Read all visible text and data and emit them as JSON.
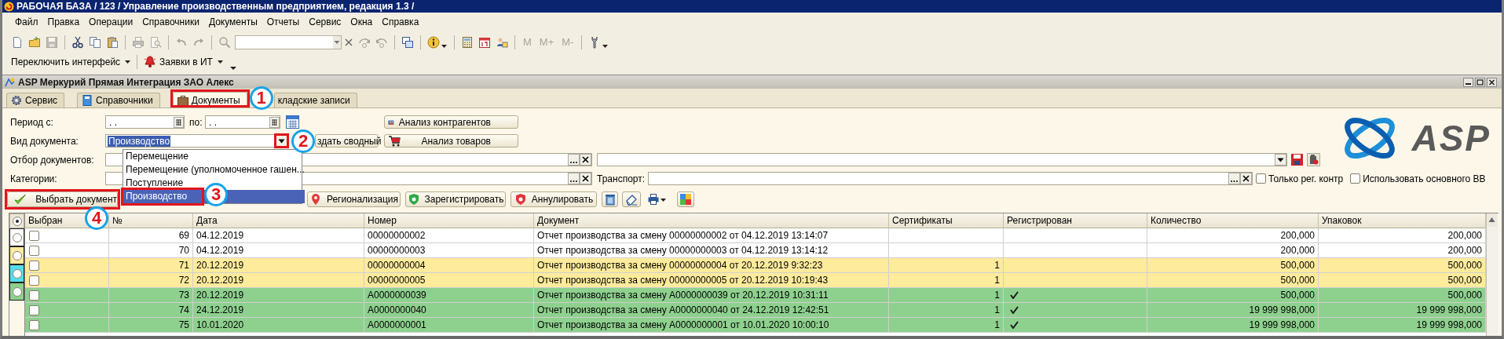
{
  "window": {
    "title": "РАБОЧАЯ БАЗА / 123 /  Управление производственным предприятием, редакция 1.3 /"
  },
  "menu": [
    "Файл",
    "Правка",
    "Операции",
    "Справочники",
    "Документы",
    "Отчеты",
    "Сервис",
    "Окна",
    "Справка"
  ],
  "toolbar": [
    {
      "kind": "button",
      "disabled": false
    },
    {
      "kind": "button",
      "disabled": false
    },
    {
      "kind": "button",
      "disabled": true
    },
    {
      "kind": "separator"
    },
    {
      "kind": "button",
      "disabled": false
    },
    {
      "kind": "button",
      "disabled": false
    },
    {
      "kind": "button",
      "disabled": false
    },
    {
      "kind": "separator"
    },
    {
      "kind": "button",
      "disabled": true
    },
    {
      "kind": "button",
      "disabled": true
    },
    {
      "kind": "separator"
    },
    {
      "kind": "button",
      "disabled": true
    },
    {
      "kind": "button",
      "disabled": true
    },
    {
      "kind": "separator"
    },
    {
      "kind": "button",
      "disabled": true
    },
    {
      "kind": "search"
    },
    {
      "kind": "button",
      "disabled": true
    },
    {
      "kind": "button",
      "disabled": true
    },
    {
      "kind": "separator"
    },
    {
      "kind": "button",
      "disabled": false
    },
    {
      "kind": "separator"
    },
    {
      "kind": "menu",
      "disabled": false
    },
    {
      "kind": "separator"
    },
    {
      "kind": "button",
      "disabled": false
    },
    {
      "kind": "button",
      "disabled": false
    },
    {
      "kind": "button",
      "disabled": false
    },
    {
      "kind": "separator"
    },
    {
      "kind": "text",
      "label": "M",
      "disabled": true
    },
    {
      "kind": "text",
      "label": "M+",
      "disabled": true
    },
    {
      "kind": "text",
      "label": "M-",
      "disabled": true
    },
    {
      "kind": "separator"
    },
    {
      "kind": "menu",
      "disabled": false
    }
  ],
  "toolbar_2": [
    {
      "kind": "menu",
      "label": "Переключить интерфейс"
    },
    {
      "kind": "bell-menu",
      "label": "Заявки в ИТ"
    }
  ],
  "form": {
    "title": "ASP Меркурий Прямая Интеграция ЗАО Алекс",
    "tabs": [
      {
        "label": "Сервис",
        "selected": false
      },
      {
        "label": "Справочники",
        "selected": false
      },
      {
        "label": "Документы",
        "selected": true,
        "callout": "1"
      },
      {
        "label": "кладские записи",
        "selected": false
      }
    ],
    "period_label": "Период с:",
    "period_from": ". .",
    "period_to_label": "по:",
    "period_to": ". .",
    "doc_type_label": "Вид документа:",
    "doc_type_value": "Производство",
    "doc_type_value_selected": true,
    "doc_type_callout": "2",
    "doc_type_options": [
      {
        "label": "Перемещение",
        "selected": false
      },
      {
        "label": "Перемещение (уполномоченное гашен...",
        "selected": false
      },
      {
        "label": "Поступление",
        "selected": false
      },
      {
        "label": "Производство",
        "selected": true,
        "callout": "3"
      }
    ],
    "create_button": "здать сводный",
    "side_buttons": [
      "Анализ контрагентов",
      "Анализ товаров"
    ],
    "doc_filter_label": "Отбор документов:",
    "category_label": "Категории:",
    "transport_label": "Транспорт:",
    "options": [
      {
        "label": "Только рег. контр",
        "checked": false
      },
      {
        "label": "Использовать основного ВВ",
        "checked": false
      }
    ],
    "actions": [
      {
        "label": "Выбрать документ",
        "callout": "4"
      },
      {
        "label": "Регионализация"
      },
      {
        "label": "Зарегистрировать"
      },
      {
        "label": "Аннулировать"
      }
    ],
    "logo": {
      "text": "ASP"
    }
  },
  "table": {
    "columns": [
      "Выбран",
      "№",
      "Дата",
      "Номер",
      "Документ",
      "Сертификаты",
      "Регистрирован",
      "Количество",
      "Упаковок"
    ],
    "legend": [
      {
        "selected": true
      },
      {
        "selected": false,
        "color": "#ffffff"
      },
      {
        "selected": false,
        "color": "#ffeb9c"
      },
      {
        "selected": false,
        "color": "#52e0ea"
      },
      {
        "selected": false,
        "color": "#8ed08e"
      }
    ],
    "rows": [
      {
        "checked": false,
        "number": "69",
        "date": "04.12.2019",
        "doc_number": "00000000002",
        "document": "Отчет производства за смену 00000000002 от 04.12.2019 13:14:07",
        "registered": false,
        "quantity": "200,000",
        "packages": "200,000",
        "color": "#ffffff"
      },
      {
        "checked": false,
        "number": "70",
        "date": "04.12.2019",
        "doc_number": "00000000003",
        "document": "Отчет производства за смену 00000000003 от 04.12.2019 13:14:12",
        "registered": false,
        "quantity": "200,000",
        "packages": "200,000",
        "color": "#ffffff"
      },
      {
        "checked": false,
        "number": "71",
        "date": "20.12.2019",
        "doc_number": "00000000004",
        "document": "Отчет производства за смену 00000000004 от 20.12.2019 9:32:23",
        "certificates": "1",
        "registered": false,
        "quantity": "500,000",
        "packages": "500,000",
        "color": "#ffeb9c"
      },
      {
        "checked": false,
        "number": "72",
        "date": "20.12.2019",
        "doc_number": "00000000005",
        "document": "Отчет производства за смену 00000000005 от 20.12.2019 10:19:43",
        "certificates": "1",
        "registered": false,
        "quantity": "500,000",
        "packages": "500,000",
        "color": "#ffeb9c"
      },
      {
        "checked": false,
        "number": "73",
        "date": "20.12.2019",
        "doc_number": "A0000000039",
        "document": "Отчет производства за смену A0000000039 от 20.12.2019 10:31:11",
        "certificates": "1",
        "registered": true,
        "quantity": "500,000",
        "packages": "500,000",
        "color": "#8ed08e"
      },
      {
        "checked": false,
        "number": "74",
        "date": "24.12.2019",
        "doc_number": "A0000000040",
        "document": "Отчет производства за смену A0000000040 от 24.12.2019 12:42:51",
        "certificates": "1",
        "registered": true,
        "quantity": "19 999 998,000",
        "packages": "19 999 998,000",
        "color": "#8ed08e"
      },
      {
        "checked": false,
        "number": "75",
        "date": "10.01.2020",
        "doc_number": "A0000000001",
        "document": "Отчет производства за смену A0000000001 от 10.01.2020 10:00:10",
        "certificates": "1",
        "registered": true,
        "quantity": "19 999 998,000",
        "packages": "19 999 998,000",
        "color": "#8ed08e"
      }
    ]
  }
}
